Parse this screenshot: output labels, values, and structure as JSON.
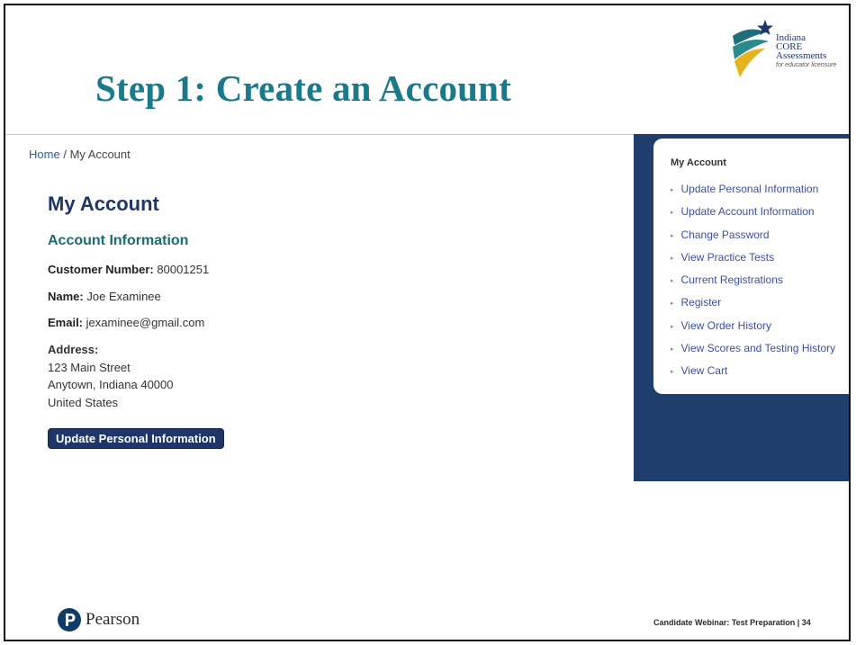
{
  "slide": {
    "title": "Step 1: Create an Account",
    "logo": {
      "line1": "Indiana",
      "line2": "CORE",
      "line3": "Assessments",
      "tagline": "for educator licensure"
    }
  },
  "breadcrumb": {
    "home": "Home",
    "separator": "/",
    "current": "My Account"
  },
  "account": {
    "heading": "My Account",
    "section_title": "Account Information",
    "customer_number_label": "Customer Number:",
    "customer_number": "80001251",
    "name_label": "Name:",
    "name": "Joe Examinee",
    "email_label": "Email:",
    "email": "jexaminee@gmail.com",
    "address_label": "Address:",
    "address_line1": "123 Main Street",
    "address_line2": "Anytown, Indiana 40000",
    "address_line3": "United States",
    "update_button": "Update Personal Information"
  },
  "sidebar": {
    "title": "My Account",
    "items": [
      {
        "label": "Update Personal Information"
      },
      {
        "label": "Update Account Information"
      },
      {
        "label": "Change Password"
      },
      {
        "label": "View Practice Tests"
      },
      {
        "label": "Current Registrations"
      },
      {
        "label": "Register"
      },
      {
        "label": "View Order History"
      },
      {
        "label": "View Scores and Testing History"
      },
      {
        "label": "View Cart"
      }
    ]
  },
  "footer": {
    "brand": "Pearson",
    "caption": "Candidate Webinar: Test Preparation | 34"
  },
  "colors": {
    "title": "#1a7a8c",
    "navy": "#1f3668",
    "panel": "#1f3e6d",
    "link": "#3b4fa0"
  }
}
